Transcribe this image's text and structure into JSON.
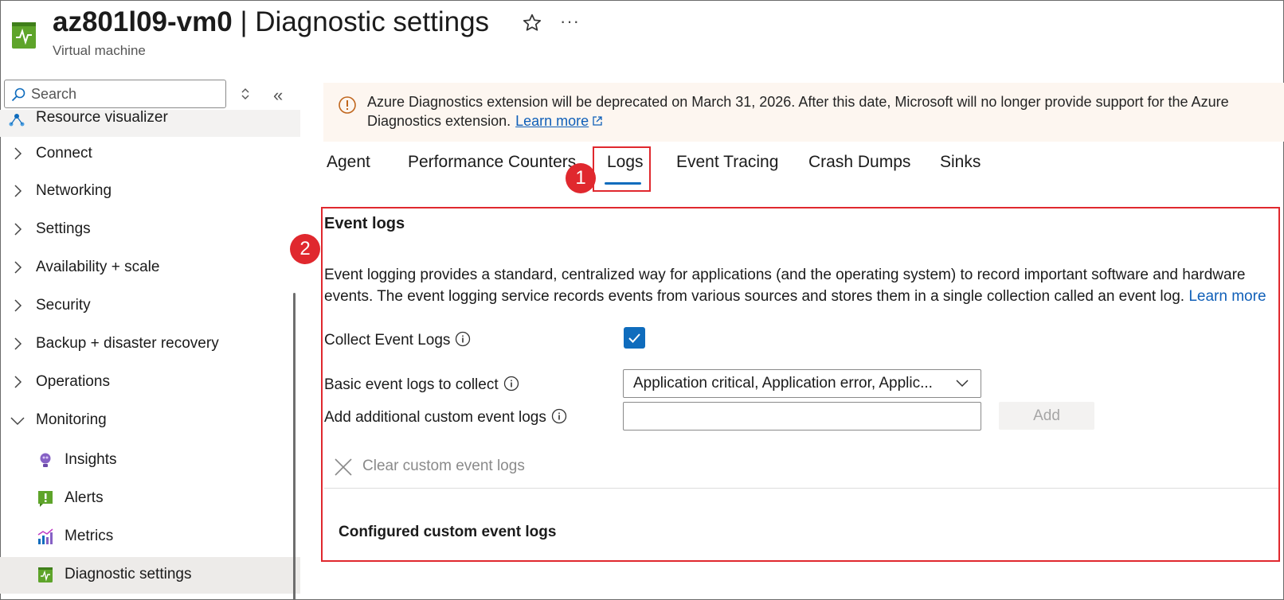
{
  "header": {
    "title_bold": "az801l09-vm0",
    "title_rest": " | Diagnostic settings",
    "subtitle": "Virtual machine",
    "more": "···"
  },
  "sidebar": {
    "search_placeholder": "Search",
    "resource_visualizer": "Resource visualizer",
    "groups": [
      {
        "label": "Connect"
      },
      {
        "label": "Networking"
      },
      {
        "label": "Settings"
      },
      {
        "label": "Availability + scale"
      },
      {
        "label": "Security"
      },
      {
        "label": "Backup + disaster recovery"
      },
      {
        "label": "Operations"
      },
      {
        "label": "Monitoring"
      }
    ],
    "monitoring_items": [
      {
        "label": "Insights",
        "icon": "insights-icon"
      },
      {
        "label": "Alerts",
        "icon": "alerts-icon"
      },
      {
        "label": "Metrics",
        "icon": "metrics-icon"
      },
      {
        "label": "Diagnostic settings",
        "icon": "diagnostic-settings-icon",
        "selected": true
      }
    ]
  },
  "banner": {
    "text": "Azure Diagnostics extension will be deprecated on March 31, 2026. After this date, Microsoft will no longer provide support for the Azure Diagnostics extension.",
    "link": "Learn more"
  },
  "tabs": [
    {
      "label": "Agent"
    },
    {
      "label": "Performance Counters"
    },
    {
      "label": "Logs",
      "active": true
    },
    {
      "label": "Event Tracing"
    },
    {
      "label": "Crash Dumps"
    },
    {
      "label": "Sinks"
    }
  ],
  "annotations": {
    "badge1": "1",
    "badge2": "2"
  },
  "event_logs": {
    "heading": "Event logs",
    "description": "Event logging provides a standard, centralized way for applications (and the operating system) to record important software and hardware events. The event logging service records events from various sources and stores them in a single collection called an event log.",
    "description_link": "Learn more",
    "collect_label": "Collect Event Logs",
    "collect_checked": true,
    "basic_label": "Basic event logs to collect",
    "basic_value": "Application critical, Application error, Applic...",
    "custom_label": "Add additional custom event logs",
    "custom_value": "",
    "add_button": "Add",
    "clear_label": "Clear custom event logs",
    "configured_heading": "Configured custom event logs"
  },
  "colors": {
    "accent": "#0f6cbd",
    "link": "#0f5fb8",
    "highlight": "#e0282e",
    "banner_bg": "#fdf6f0",
    "warning": "#c0661d"
  }
}
